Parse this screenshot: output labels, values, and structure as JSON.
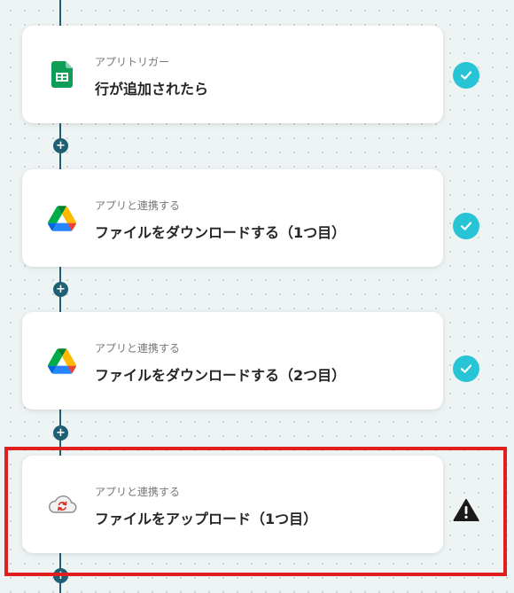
{
  "steps": [
    {
      "icon": "google-sheets-icon",
      "type_label": "アプリトリガー",
      "title": "行が追加されたら",
      "status": "completed"
    },
    {
      "icon": "google-drive-icon",
      "type_label": "アプリと連携する",
      "title": "ファイルをダウンロードする（1つ目）",
      "status": "completed"
    },
    {
      "icon": "google-drive-icon",
      "type_label": "アプリと連携する",
      "title": "ファイルをダウンロードする（2つ目）",
      "status": "completed"
    },
    {
      "icon": "cloud-sync-icon",
      "type_label": "アプリと連携する",
      "title": "ファイルをアップロード（1つ目）",
      "status": "warning"
    }
  ],
  "add_step_symbol": "+",
  "colors": {
    "connector": "#1f5f73",
    "completed": "#27c4d5",
    "warning": "#1a1a1a",
    "highlight": "#e11f1f",
    "sheets_green": "#0f9d58"
  }
}
